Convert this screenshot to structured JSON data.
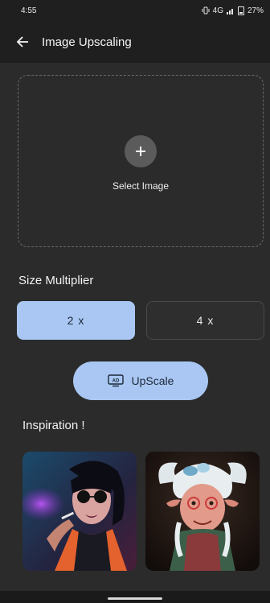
{
  "status_bar": {
    "time": "4:55",
    "indicators": "4G",
    "battery": "27%",
    "icons": [
      "vibrate-icon",
      "signal-icon",
      "battery-icon"
    ]
  },
  "app_bar": {
    "title": "Image Upscaling",
    "back_icon": "back-arrow-icon"
  },
  "upload": {
    "label": "Select Image",
    "icon": "plus-icon"
  },
  "size_multiplier": {
    "title": "Size Multiplier",
    "options": [
      {
        "label": "2 x",
        "selected": true
      },
      {
        "label": "4 x",
        "selected": false
      }
    ]
  },
  "action": {
    "upscale_label": "UpScale",
    "icon": "ad-icon"
  },
  "inspiration": {
    "title": "Inspiration !",
    "images": [
      "woman-with-sunglasses-image",
      "elderly-woman-character-image"
    ]
  },
  "colors": {
    "background": "#2b2b2b",
    "appbar": "#1f1f1f",
    "accent": "#a9c7f2",
    "accent_text": "#1c2838"
  }
}
